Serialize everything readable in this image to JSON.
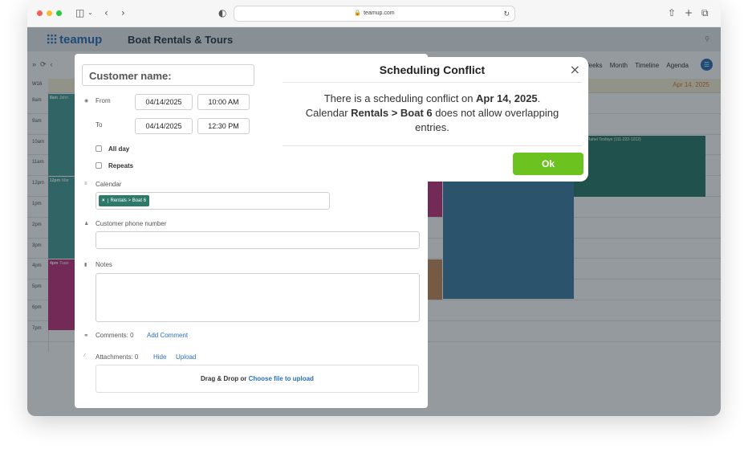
{
  "browser": {
    "url": "teamup.com",
    "icons": [
      "sidebar-icon",
      "back-icon",
      "forward-icon",
      "shield-icon",
      "reload-icon",
      "share-icon",
      "new-tab-icon",
      "tabs-icon"
    ]
  },
  "app": {
    "logo": "teamup",
    "title": "Boat Rentals & Tours",
    "views": [
      "ek",
      "4 Weeks",
      "Month",
      "Timeline",
      "Agenda"
    ]
  },
  "calendar": {
    "week_label": "W16",
    "date_label": "Apr 14, 2025",
    "hours": [
      "8am",
      "9am",
      "10am",
      "11am",
      "12pm",
      "1pm",
      "2pm",
      "3pm",
      "4pm",
      "5pm",
      "6pm",
      "7pm"
    ],
    "events": [
      {
        "time": "8am",
        "title": "John"
      },
      {
        "time": "12pm",
        "title": "Mar"
      },
      {
        "time": "4pm",
        "title": "Tuan"
      },
      {
        "time": "10am",
        "title": "Rahel Tesfaye (111-222-1212)"
      }
    ]
  },
  "form": {
    "customer_placeholder": "Customer name:",
    "from_label": "From",
    "to_label": "To",
    "from_date": "04/14/2025",
    "from_time": "10:00 AM",
    "to_date": "04/14/2025",
    "to_time": "12:30 PM",
    "all_day_label": "All day",
    "repeats_label": "Repeats",
    "calendar_label": "Calendar",
    "calendar_chip": "Rentals > Boat 6",
    "chip_remove": "×",
    "phone_label": "Customer phone number",
    "notes_label": "Notes",
    "comments_label": "Comments: 0",
    "add_comment": "Add Comment",
    "attachments_label": "Attachments: 0",
    "hide": "Hide",
    "upload": "Upload",
    "dropzone_text": "Drag & Drop or",
    "dropzone_link": "Choose file to upload"
  },
  "modal": {
    "title": "Scheduling Conflict",
    "close": "×",
    "line1_pre": "There is a scheduling conflict on ",
    "line1_date": "Apr 14, 2025",
    "line1_post": ".",
    "line2_pre": "Calendar ",
    "line2_cal": "Rentals > Boat 6",
    "line2_post": " does not allow overlapping entries.",
    "ok": "Ok"
  },
  "colors": {
    "teal": "#4a9e98",
    "magenta": "#c2347c",
    "blue": "#3f7ea2",
    "dark_teal": "#2c7a6b",
    "orange": "#c98a5c",
    "ok_green": "#6cc21f"
  }
}
